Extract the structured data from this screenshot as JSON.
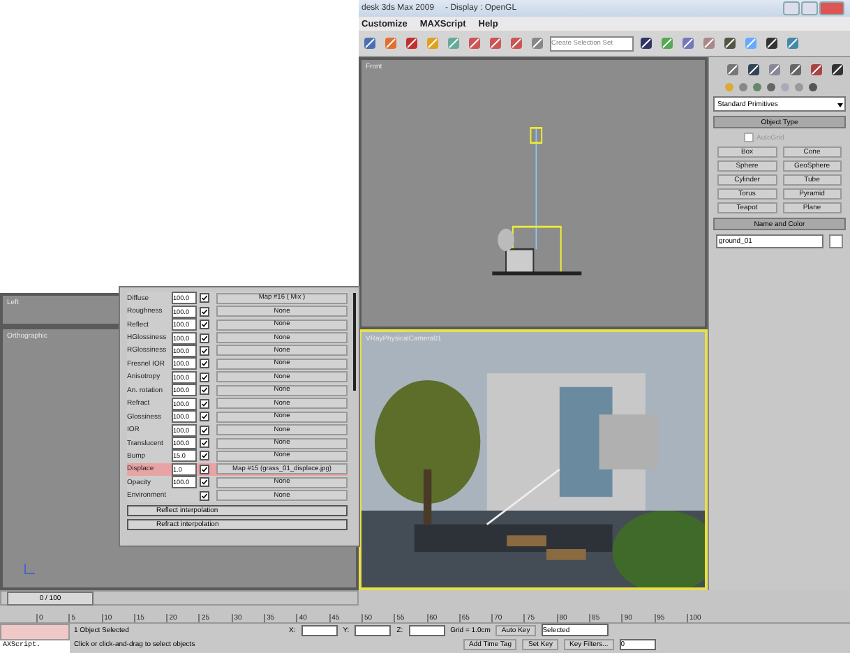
{
  "window": {
    "title": "desk 3ds Max 2009",
    "subtitle": "- Display : OpenGL"
  },
  "menu": [
    "Customize",
    "MAXScript",
    "Help"
  ],
  "toolbar": {
    "selection_set": "Create Selection Set"
  },
  "viewports": [
    {
      "label": "Left",
      "active": false
    },
    {
      "label": "Orthographic",
      "active": false
    },
    {
      "label": "Front",
      "active": false
    },
    {
      "label": "VRayPhysicalCamera01",
      "active": true
    }
  ],
  "command_panel": {
    "category": "Standard Primitives",
    "object_type": {
      "title": "Object Type",
      "autogrid": {
        "label": "AutoGrid",
        "checked": false,
        "disabled": true
      },
      "buttons": [
        "Box",
        "Cone",
        "Sphere",
        "GeoSphere",
        "Cylinder",
        "Tube",
        "Torus",
        "Pyramid",
        "Teapot",
        "Plane"
      ]
    },
    "name_color": {
      "title": "Name and Color",
      "name": "ground_01"
    }
  },
  "material": {
    "rows": [
      {
        "name": "Diffuse",
        "value": "100.0",
        "enabled": true,
        "map": "Map #16 ( Mix )",
        "highlighted": false
      },
      {
        "name": "Roughness",
        "value": "100.0",
        "enabled": true,
        "map": "None",
        "highlighted": false
      },
      {
        "name": "Reflect",
        "value": "100.0",
        "enabled": true,
        "map": "None",
        "highlighted": false
      },
      {
        "name": "HGlossiness",
        "value": "100.0",
        "enabled": true,
        "map": "None",
        "highlighted": false
      },
      {
        "name": "RGlossiness",
        "value": "100.0",
        "enabled": true,
        "map": "None",
        "highlighted": false
      },
      {
        "name": "Fresnel IOR",
        "value": "100.0",
        "enabled": true,
        "map": "None",
        "highlighted": false
      },
      {
        "name": "Anisotropy",
        "value": "100.0",
        "enabled": true,
        "map": "None",
        "highlighted": false
      },
      {
        "name": "An. rotation",
        "value": "100.0",
        "enabled": true,
        "map": "None",
        "highlighted": false
      },
      {
        "name": "Refract",
        "value": "100.0",
        "enabled": true,
        "map": "None",
        "highlighted": false
      },
      {
        "name": "Glossiness",
        "value": "100.0",
        "enabled": true,
        "map": "None",
        "highlighted": false
      },
      {
        "name": "IOR",
        "value": "100.0",
        "enabled": true,
        "map": "None",
        "highlighted": false
      },
      {
        "name": "Translucent",
        "value": "100.0",
        "enabled": true,
        "map": "None",
        "highlighted": false
      },
      {
        "name": "Bump",
        "value": "15.0",
        "enabled": true,
        "map": "None",
        "highlighted": false
      },
      {
        "name": "Displace",
        "value": "1.0",
        "enabled": true,
        "map": "Map #15 (grass_01_displace.jpg)",
        "highlighted": true
      },
      {
        "name": "Opacity",
        "value": "100.0",
        "enabled": true,
        "map": "None",
        "highlighted": false
      },
      {
        "name": "Environment",
        "enabled": true,
        "map": "None",
        "highlighted": false
      }
    ],
    "rollouts": [
      "Reflect interpolation",
      "Refract interpolation"
    ]
  },
  "time_slider": {
    "position": "0 / 100",
    "level": 0
  },
  "ruler": [
    "0",
    "5",
    "10",
    "15",
    "20",
    "25",
    "30",
    "35",
    "40",
    "45",
    "50",
    "55",
    "60",
    "65",
    "70",
    "75",
    "80",
    "85",
    "90",
    "95",
    "100"
  ],
  "status": {
    "listener": "AXScript.",
    "selection": "1 Object Selected",
    "prompt": "Click or click-and-drag to select objects",
    "x_label": "X:",
    "y_label": "Y:",
    "z_label": "Z:",
    "grid": "Grid = 1.0cm",
    "time_tag": "Add Time Tag",
    "auto_key": "Auto Key",
    "key_mode": "Selected",
    "set_key": "Set Key",
    "key_filters": "Key Filters...",
    "frame": "0"
  }
}
